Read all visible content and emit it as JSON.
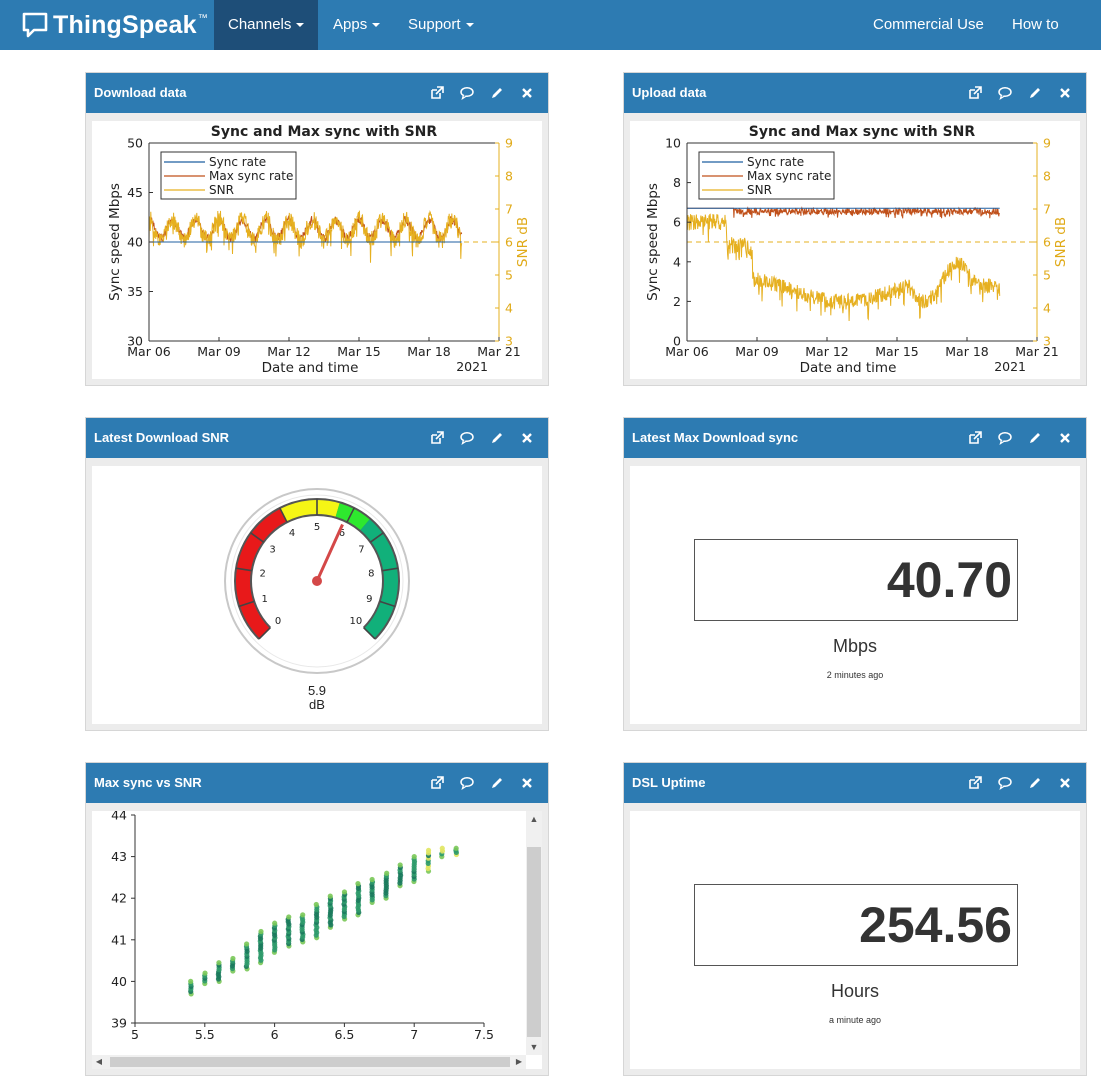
{
  "nav": {
    "brand": "ThingSpeak",
    "brand_tm": "™",
    "items": [
      {
        "label": "Channels",
        "active": true,
        "dropdown": true
      },
      {
        "label": "Apps",
        "active": false,
        "dropdown": true
      },
      {
        "label": "Support",
        "active": false,
        "dropdown": true
      }
    ],
    "right_items": [
      {
        "label": "Commercial Use"
      },
      {
        "label": "How to Buy"
      }
    ]
  },
  "panel_tools": [
    "external-link-icon",
    "comment-icon",
    "pencil-icon",
    "close-icon"
  ],
  "panels": {
    "download": {
      "title": "Download data",
      "chart_data": {
        "type": "line",
        "title": "Sync and Max sync with SNR",
        "xlabel": "Date and time",
        "x_year_label": "2021",
        "x": [
          "Mar 06",
          "Mar 09",
          "Mar 12",
          "Mar 15",
          "Mar 18",
          "Mar 21"
        ],
        "ylabel": "Sync speed Mbps",
        "ylim": [
          30,
          50
        ],
        "yticks": [
          "30",
          "35",
          "40",
          "45",
          "50"
        ],
        "y2label": "SNR dB",
        "y2lim": [
          3,
          9
        ],
        "y2ticks": [
          "3",
          "4",
          "5",
          "6",
          "7",
          "8",
          "9"
        ],
        "legend_position": "top-left",
        "series": [
          {
            "name": "Sync rate",
            "color": "#1f5fa0",
            "approx_level": 40.0
          },
          {
            "name": "Max sync rate",
            "color": "#c0501a",
            "approx_range": [
              40,
              43.5
            ]
          },
          {
            "name": "SNR",
            "color": "#e6b020",
            "approx_range": [
              5.5,
              7.2
            ]
          }
        ],
        "reference_line_y2": 6
      }
    },
    "upload": {
      "title": "Upload data",
      "chart_data": {
        "type": "line",
        "title": "Sync and Max sync with SNR",
        "xlabel": "Date and time",
        "x_year_label": "2021",
        "x": [
          "Mar 06",
          "Mar 09",
          "Mar 12",
          "Mar 15",
          "Mar 18",
          "Mar 21"
        ],
        "ylabel": "Sync speed Mbps",
        "ylim": [
          0,
          10
        ],
        "yticks": [
          "0",
          "2",
          "4",
          "6",
          "8",
          "10"
        ],
        "y2label": "SNR dB",
        "y2lim": [
          3,
          9
        ],
        "y2ticks": [
          "3",
          "4",
          "5",
          "6",
          "7",
          "8",
          "9"
        ],
        "legend_position": "top-left",
        "series": [
          {
            "name": "Sync rate",
            "color": "#1f5fa0",
            "approx_level": 6.7
          },
          {
            "name": "Max sync rate",
            "color": "#c0501a",
            "approx_range": [
              6.3,
              6.8
            ]
          },
          {
            "name": "SNR",
            "color": "#e6b020",
            "approx_range": [
              3.3,
              7.2
            ]
          }
        ],
        "reference_line_y2": 6
      }
    },
    "snr_gauge": {
      "title": "Latest Download SNR",
      "value": "5.9",
      "unit": "dB",
      "gauge": {
        "min": 0,
        "max": 10,
        "value": 5.9,
        "ticks": [
          "0",
          "1",
          "2",
          "3",
          "4",
          "5",
          "6",
          "7",
          "8",
          "9",
          "10"
        ],
        "bands": [
          {
            "from": 0,
            "to": 4,
            "color": "#e8191a"
          },
          {
            "from": 4,
            "to": 5.6,
            "color": "#f5f515"
          },
          {
            "from": 5.6,
            "to": 6.5,
            "color": "#2ee82e"
          },
          {
            "from": 6.5,
            "to": 10,
            "color": "#11b07a"
          }
        ]
      }
    },
    "max_download": {
      "title": "Latest Max Download sync",
      "value": "40.70",
      "unit": "Mbps",
      "updated": "2 minutes ago"
    },
    "scatter": {
      "title": "Max sync vs SNR",
      "chart_data": {
        "type": "scatter",
        "xlim": [
          5,
          7.5
        ],
        "ylim": [
          39,
          44
        ],
        "xticks": [
          "5",
          "5.5",
          "6",
          "6.5",
          "7",
          "7.5"
        ],
        "yticks": [
          "39",
          "40",
          "41",
          "42",
          "43",
          "44"
        ],
        "columns": [
          {
            "x": 5.4,
            "y_min": 39.7,
            "y_max": 40.0
          },
          {
            "x": 5.5,
            "y_min": 39.95,
            "y_max": 40.2
          },
          {
            "x": 5.6,
            "y_min": 40.0,
            "y_max": 40.45
          },
          {
            "x": 5.7,
            "y_min": 40.25,
            "y_max": 40.55
          },
          {
            "x": 5.8,
            "y_min": 40.3,
            "y_max": 40.9
          },
          {
            "x": 5.9,
            "y_min": 40.45,
            "y_max": 41.2
          },
          {
            "x": 6.0,
            "y_min": 40.7,
            "y_max": 41.4
          },
          {
            "x": 6.1,
            "y_min": 40.85,
            "y_max": 41.55
          },
          {
            "x": 6.2,
            "y_min": 40.95,
            "y_max": 41.6
          },
          {
            "x": 6.3,
            "y_min": 41.05,
            "y_max": 41.85
          },
          {
            "x": 6.4,
            "y_min": 41.3,
            "y_max": 42.05
          },
          {
            "x": 6.5,
            "y_min": 41.5,
            "y_max": 42.15
          },
          {
            "x": 6.6,
            "y_min": 41.6,
            "y_max": 42.35
          },
          {
            "x": 6.7,
            "y_min": 41.9,
            "y_max": 42.45
          },
          {
            "x": 6.8,
            "y_min": 42.0,
            "y_max": 42.6
          },
          {
            "x": 6.9,
            "y_min": 42.3,
            "y_max": 42.8
          },
          {
            "x": 7.0,
            "y_min": 42.4,
            "y_max": 43.0
          },
          {
            "x": 7.1,
            "y_min": 42.65,
            "y_max": 43.15
          },
          {
            "x": 7.2,
            "y_min": 43.0,
            "y_max": 43.2
          },
          {
            "x": 7.3,
            "y_min": 43.05,
            "y_max": 43.2
          }
        ],
        "colors": [
          "#1a7a5c",
          "#2e9a6a",
          "#7ac858",
          "#e0e660"
        ]
      }
    },
    "uptime": {
      "title": "DSL Uptime",
      "value": "254.56",
      "unit": "Hours",
      "updated": "a minute ago"
    }
  }
}
